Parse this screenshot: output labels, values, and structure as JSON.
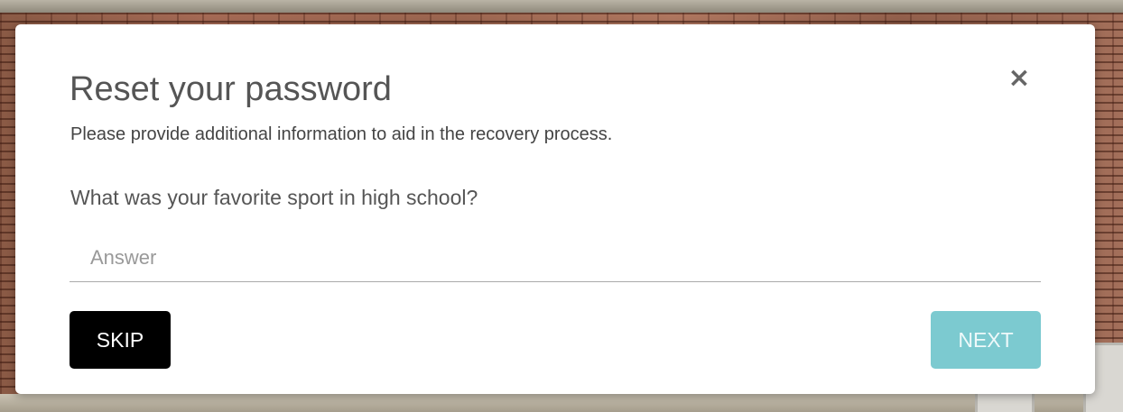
{
  "dialog": {
    "title": "Reset your password",
    "subtitle": "Please provide additional information to aid in the recovery process.",
    "close_symbol": "×",
    "question": "What was your favorite sport in high school?",
    "answer": {
      "value": "",
      "placeholder": "Answer"
    },
    "skip_label": "SKIP",
    "next_label": "NEXT"
  },
  "icons": {
    "close": "close-icon"
  },
  "colors": {
    "skip_button": "#000000",
    "next_button": "#7ccad0",
    "title_text": "#555555"
  }
}
